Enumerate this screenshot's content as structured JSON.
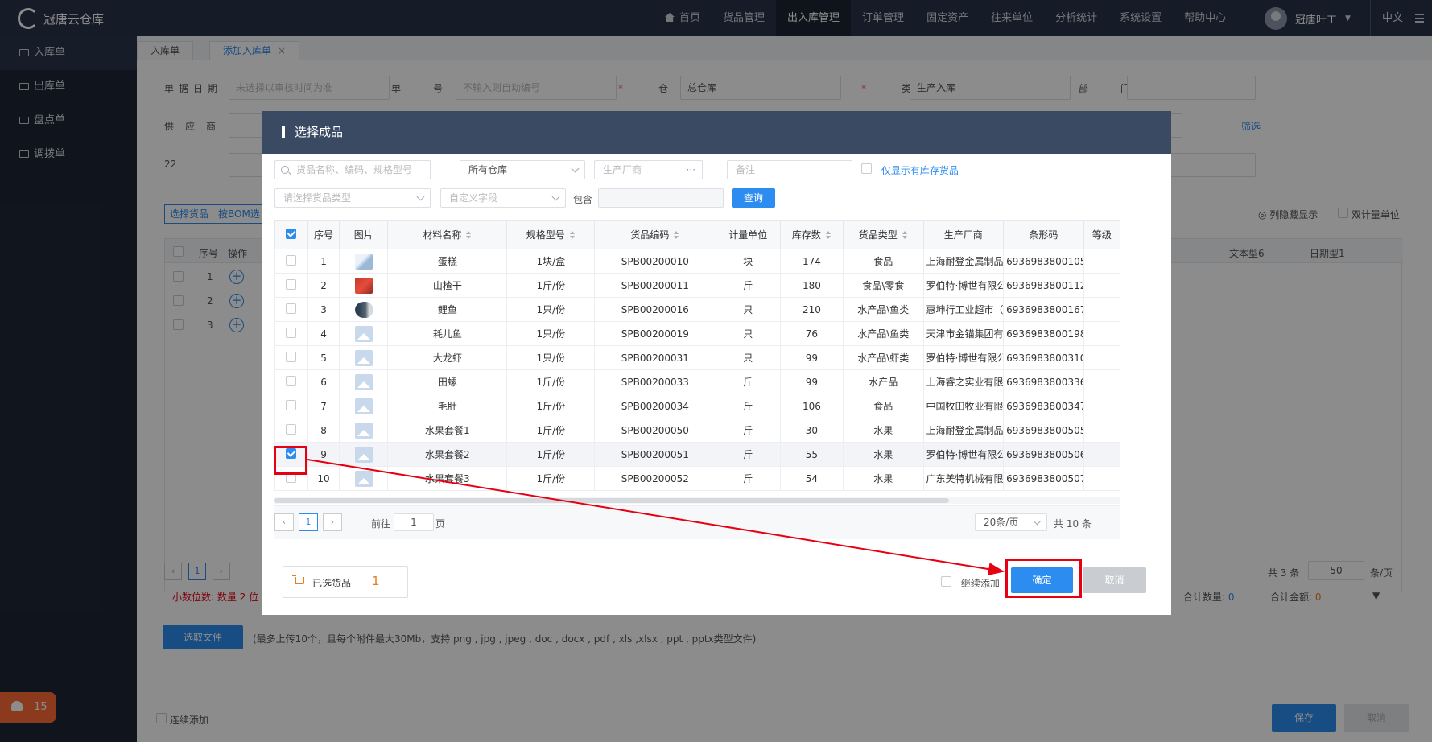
{
  "app": {
    "title": "冠唐云仓库"
  },
  "topnav": {
    "items": [
      "首页",
      "货品管理",
      "出入库管理",
      "订单管理",
      "固定资产",
      "往来单位",
      "分析统计",
      "系统设置",
      "帮助中心"
    ],
    "active": "出入库管理"
  },
  "user": {
    "name": "冠唐叶工",
    "lang": "中文"
  },
  "sidebar": {
    "items": [
      {
        "label": "入库单",
        "active": true
      },
      {
        "label": "出库单",
        "active": false
      },
      {
        "label": "盘点单",
        "active": false
      },
      {
        "label": "调拨单",
        "active": false
      }
    ],
    "alarm_count": "15"
  },
  "tabs": [
    {
      "label": "入库单",
      "active": false
    },
    {
      "label": "添加入库单",
      "active": true,
      "close": "×"
    }
  ],
  "form": {
    "date_label": "单据日期",
    "date_placeholder": "未选择以审核时间为准",
    "no_label": "单号",
    "no_placeholder": "不输入则自动编号",
    "warehouse_label": "仓库",
    "warehouse_value": "总仓库",
    "type_label": "类型",
    "type_value": "生产入库",
    "dept_label": "部门",
    "supplier_label": "供应商",
    "filter_link": "筛选",
    "row3_label": "22",
    "select_goods_btn": "选择货品",
    "bom_btn": "按BOM选",
    "col_toggle": "列隐藏显示",
    "dual_unit": "双计量单位",
    "header_seq": "序号",
    "header_op": "操作",
    "header_text6": "文本型6",
    "header_date1": "日期型1",
    "rows": [
      "1",
      "2",
      "3"
    ],
    "total_rows": "共 3 条",
    "page_size": "50",
    "page_size_unit": "条/页",
    "decimal_note": "小数位数: 数量 2 位",
    "total_qty_label": "合计数量:",
    "total_qty": "0",
    "total_amount_label": "合计金额:",
    "total_amount": "0",
    "upload_btn": "选取文件",
    "upload_note": "(最多上传10个，且每个附件最大30Mb，支持 png , jpg , jpeg , doc , docx , pdf , xls ,xlsx , ppt , pptx类型文件)",
    "continue_add": "连续添加",
    "save_btn": "保存",
    "cancel_btn": "取消"
  },
  "modal": {
    "title": "选择成品",
    "search_placeholder": "货品名称、编码、规格型号",
    "warehouse_select": "所有仓库",
    "maker_placeholder": "生产厂商",
    "remark_placeholder": "备注",
    "only_stock_label": "仅显示有库存货品",
    "category_placeholder": "请选择货品类型",
    "custom_field_placeholder": "自定义字段",
    "contains_label": "包含",
    "query_btn": "查询",
    "columns": [
      "序号",
      "图片",
      "材料名称",
      "规格型号",
      "货品编码",
      "计量单位",
      "库存数",
      "货品类型",
      "生产厂商",
      "条形码",
      "等级"
    ],
    "rows": [
      {
        "seq": "1",
        "thumb": "cake",
        "name": "蛋糕",
        "spec": "1块/盒",
        "code": "SPB00200010",
        "unit": "块",
        "stock": "174",
        "category": "食品",
        "maker": "上海耐登金属制品",
        "barcode": "6936983800105",
        "checked": false
      },
      {
        "seq": "2",
        "thumb": "hawthorn",
        "name": "山楂干",
        "spec": "1斤/份",
        "code": "SPB00200011",
        "unit": "斤",
        "stock": "180",
        "category": "食品\\零食",
        "maker": "罗伯特·博世有限公",
        "barcode": "6936983800112",
        "checked": false
      },
      {
        "seq": "3",
        "thumb": "carp",
        "name": "鲤鱼",
        "spec": "1只/份",
        "code": "SPB00200016",
        "unit": "只",
        "stock": "210",
        "category": "水产品\\鱼类",
        "maker": "惠坤行工业超市（",
        "barcode": "6936983800167",
        "checked": false
      },
      {
        "seq": "4",
        "thumb": "ph",
        "name": "耗儿鱼",
        "spec": "1只/份",
        "code": "SPB00200019",
        "unit": "只",
        "stock": "76",
        "category": "水产品\\鱼类",
        "maker": "天津市金锚集团有",
        "barcode": "6936983800198",
        "checked": false
      },
      {
        "seq": "5",
        "thumb": "ph",
        "name": "大龙虾",
        "spec": "1只/份",
        "code": "SPB00200031",
        "unit": "只",
        "stock": "99",
        "category": "水产品\\虾类",
        "maker": "罗伯特·博世有限公",
        "barcode": "6936983800310",
        "checked": false
      },
      {
        "seq": "6",
        "thumb": "ph",
        "name": "田螺",
        "spec": "1斤/份",
        "code": "SPB00200033",
        "unit": "斤",
        "stock": "99",
        "category": "水产品",
        "maker": "上海睿之实业有限",
        "barcode": "6936983800336",
        "checked": false
      },
      {
        "seq": "7",
        "thumb": "ph",
        "name": "毛肚",
        "spec": "1斤/份",
        "code": "SPB00200034",
        "unit": "斤",
        "stock": "106",
        "category": "食品",
        "maker": "中国牧田牧业有限",
        "barcode": "6936983800347",
        "checked": false
      },
      {
        "seq": "8",
        "thumb": "ph",
        "name": "水果套餐1",
        "spec": "1斤/份",
        "code": "SPB00200050",
        "unit": "斤",
        "stock": "30",
        "category": "水果",
        "maker": "上海耐登金属制品",
        "barcode": "6936983800505",
        "checked": false
      },
      {
        "seq": "9",
        "thumb": "ph",
        "name": "水果套餐2",
        "spec": "1斤/份",
        "code": "SPB00200051",
        "unit": "斤",
        "stock": "55",
        "category": "水果",
        "maker": "罗伯特·博世有限公",
        "barcode": "6936983800506",
        "checked": true
      },
      {
        "seq": "10",
        "thumb": "ph",
        "name": "水果套餐3",
        "spec": "1斤/份",
        "code": "SPB00200052",
        "unit": "斤",
        "stock": "54",
        "category": "水果",
        "maker": "广东美特机械有限",
        "barcode": "6936983800507",
        "checked": false
      }
    ],
    "pager": {
      "current": "1",
      "goto_label": "前往",
      "goto_value": "1",
      "page_unit": "页",
      "page_size": "20条/页",
      "total": "共 10 条"
    },
    "selected_label": "已选货品",
    "selected_count": "1",
    "continue_add": "继续添加",
    "confirm_btn": "确定",
    "cancel_btn": "取消"
  },
  "colors": {
    "primary": "#2d8cf0",
    "highlight": "#e60012",
    "header": "#283447",
    "modal_header": "#3b4a63"
  }
}
